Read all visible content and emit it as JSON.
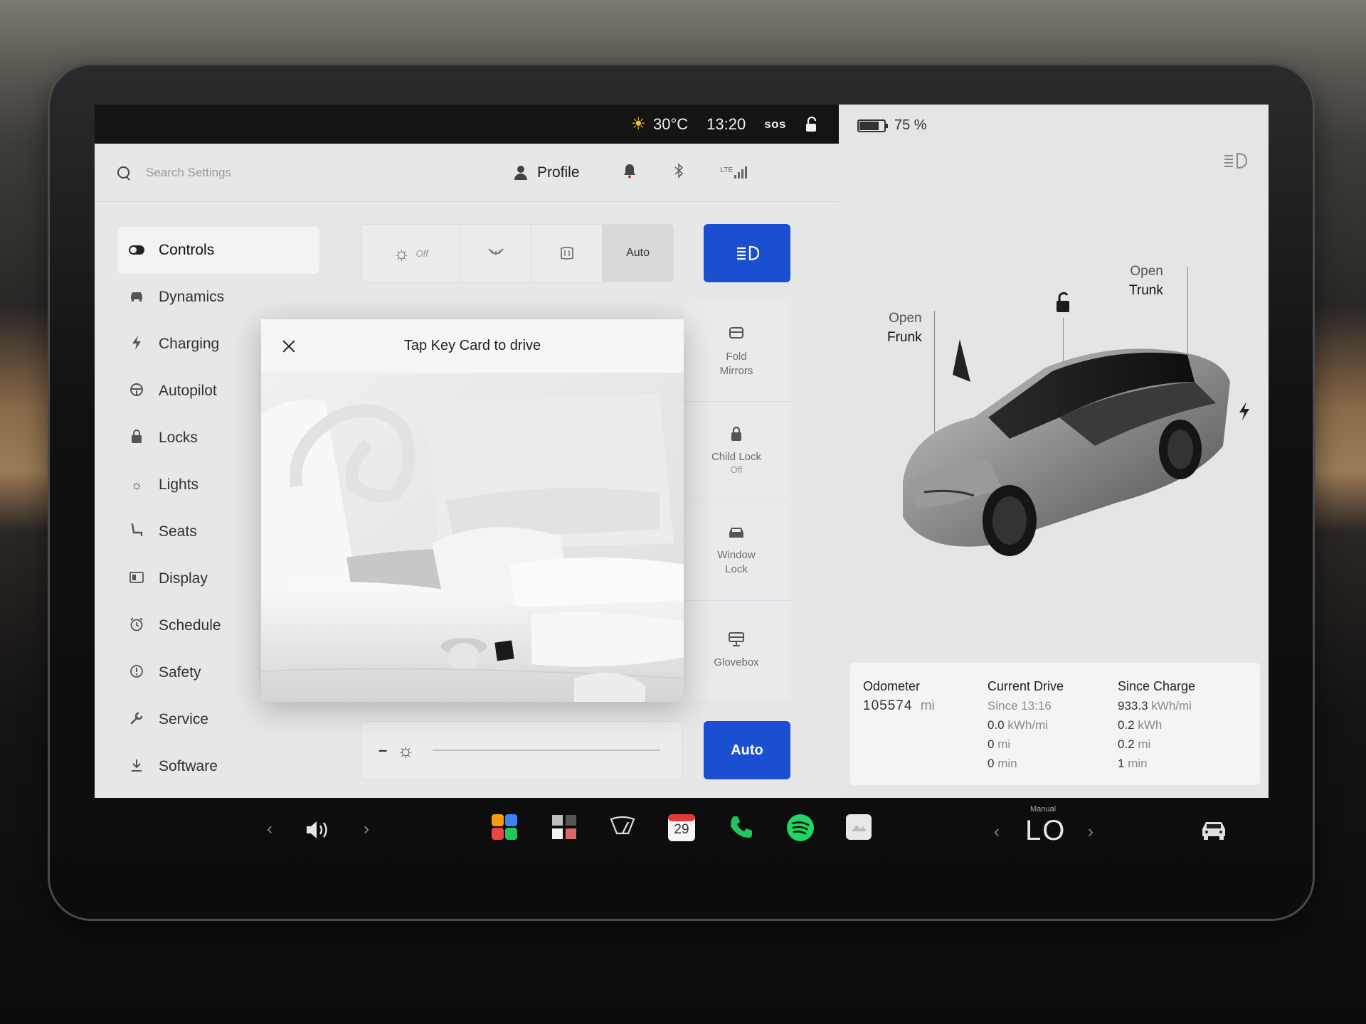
{
  "status": {
    "temperature": "30°C",
    "time": "13:20",
    "sos": "sos"
  },
  "search": {
    "placeholder": "Search Settings"
  },
  "profile": {
    "label": "Profile"
  },
  "lte": {
    "label": "LTE"
  },
  "sidebar": {
    "items": [
      {
        "label": "Controls",
        "icon": "toggle-icon",
        "active": true
      },
      {
        "label": "Dynamics",
        "icon": "car-icon"
      },
      {
        "label": "Charging",
        "icon": "bolt-icon"
      },
      {
        "label": "Autopilot",
        "icon": "steering-wheel-icon"
      },
      {
        "label": "Locks",
        "icon": "lock-icon"
      },
      {
        "label": "Lights",
        "icon": "light-icon"
      },
      {
        "label": "Seats",
        "icon": "seat-icon"
      },
      {
        "label": "Display",
        "icon": "display-icon"
      },
      {
        "label": "Schedule",
        "icon": "alarm-icon"
      },
      {
        "label": "Safety",
        "icon": "info-icon"
      },
      {
        "label": "Service",
        "icon": "wrench-icon"
      },
      {
        "label": "Software",
        "icon": "download-icon"
      }
    ]
  },
  "lights_segment": {
    "off_label": "Off",
    "auto_label": "Auto"
  },
  "tiles": [
    {
      "line1": "Fold",
      "line2": "Mirrors",
      "icon": "mirror-icon"
    },
    {
      "line1": "Child Lock",
      "line2": "Off",
      "icon": "lock-icon"
    },
    {
      "line1": "Window",
      "line2": "Lock",
      "icon": "window-icon"
    },
    {
      "line1": "Glovebox",
      "line2": "",
      "icon": "glovebox-icon"
    }
  ],
  "brightness": {
    "minus": "–",
    "auto_label": "Auto"
  },
  "modal": {
    "title": "Tap Key Card to drive"
  },
  "battery": {
    "percent_label": "75 %",
    "level": 0.75
  },
  "car": {
    "frunk": {
      "line1": "Open",
      "line2": "Frunk"
    },
    "trunk": {
      "line1": "Open",
      "line2": "Trunk"
    }
  },
  "stats": {
    "odometer": {
      "label": "Odometer",
      "value": "105574",
      "unit": "mi"
    },
    "current_drive": {
      "label": "Current Drive",
      "since": "Since 13:16",
      "energy_value": "0.0",
      "energy_unit": "kWh/mi",
      "distance_value": "0",
      "distance_unit": "mi",
      "time_value": "0",
      "time_unit": "min"
    },
    "since_charge": {
      "label": "Since Charge",
      "efficiency_value": "933.3",
      "efficiency_unit": "kWh/mi",
      "energy_value": "0.2",
      "energy_unit": "kWh",
      "distance_value": "0.2",
      "distance_unit": "mi",
      "time_value": "1",
      "time_unit": "min"
    }
  },
  "dock": {
    "calendar_day": "29",
    "climate_mode": "Manual",
    "climate_value": "LO",
    "colors": {
      "phone": "#22c55e",
      "spotify": "#1ed760",
      "calendar": "#e53935"
    }
  }
}
